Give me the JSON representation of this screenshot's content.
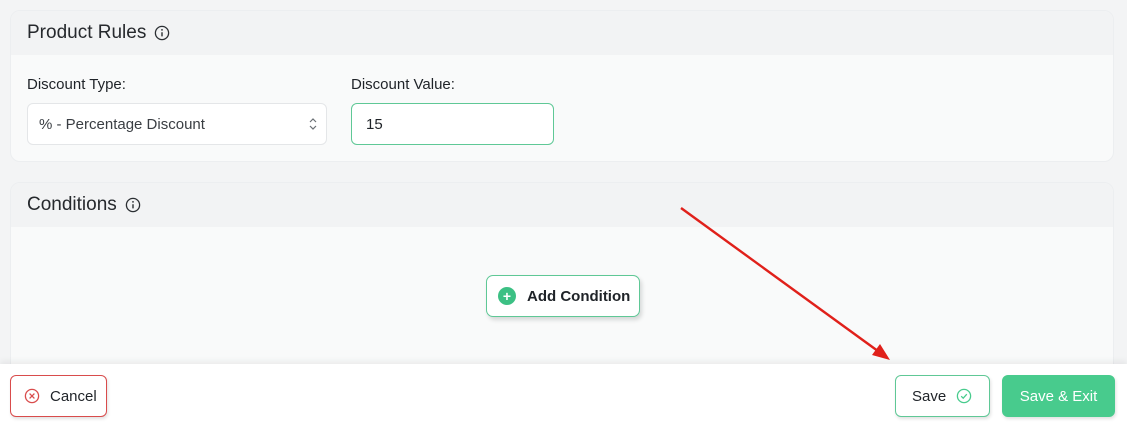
{
  "product_rules": {
    "title": "Product Rules",
    "info_icon": "info-circle-icon",
    "discount_type": {
      "label": "Discount Type:",
      "selected": "% - Percentage Discount"
    },
    "discount_value": {
      "label": "Discount Value:",
      "value": "15"
    }
  },
  "conditions": {
    "title": "Conditions",
    "info_icon": "info-circle-icon",
    "add_label": "Add Condition"
  },
  "footer": {
    "cancel_label": "Cancel",
    "save_label": "Save",
    "save_exit_label": "Save & Exit"
  },
  "colors": {
    "accent_green": "#48cb8d",
    "border_green": "#5fc896",
    "cancel_red": "#d94c4c",
    "annotation_arrow": "#e0201a"
  }
}
